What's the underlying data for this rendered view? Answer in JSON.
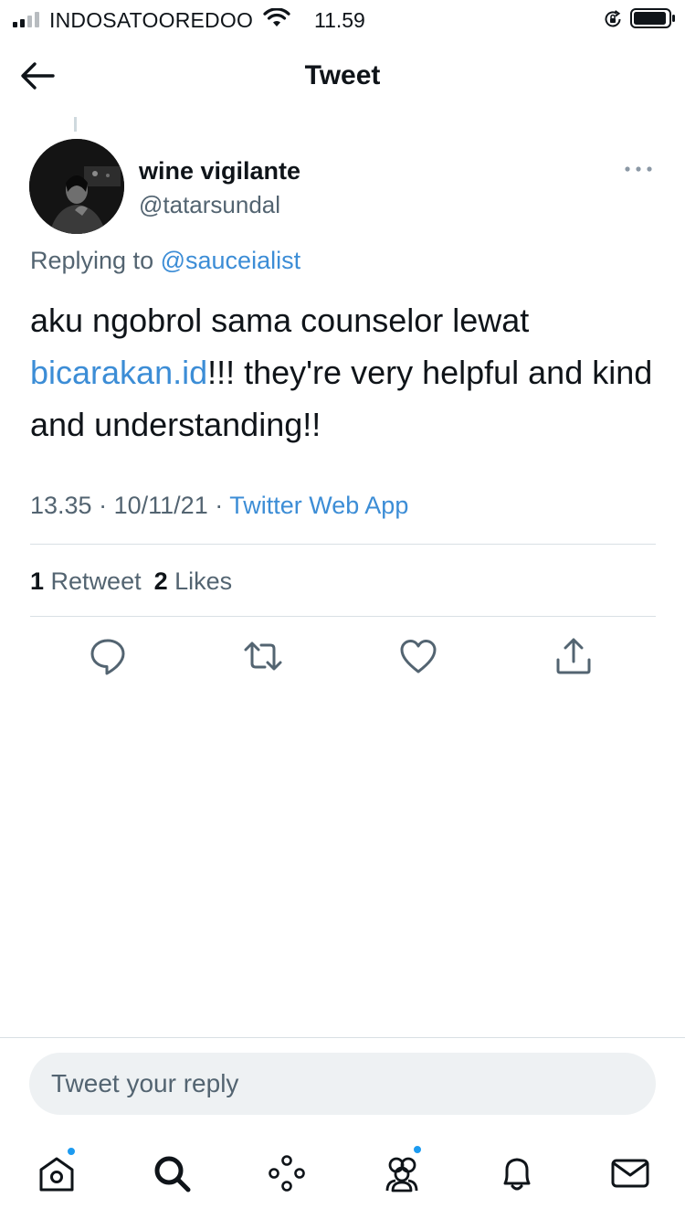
{
  "status_bar": {
    "carrier": "INDOSATOOREDOO",
    "time": "11.59"
  },
  "header": {
    "title": "Tweet",
    "back_icon": "arrow-left-icon"
  },
  "tweet": {
    "display_name": "wine vigilante",
    "handle": "@tatarsundal",
    "replying_prefix": "Replying to",
    "replying_to": "@sauceialist",
    "text_line1": "aku ngobrol sama counselor lewat",
    "text_link": "bicarakan.id",
    "text_after_link": "!!! they're very helpful and kind and understanding!!",
    "time": "13.35",
    "date": "10/11/21",
    "separator": "·",
    "source": "Twitter Web App",
    "retweet_count": "1",
    "retweet_label": "Retweet",
    "like_count": "2",
    "like_label": "Likes"
  },
  "actions": [
    "reply-icon",
    "retweet-icon",
    "like-icon",
    "share-icon"
  ],
  "reply_box": {
    "placeholder": "Tweet your reply"
  },
  "tabs": [
    "home-icon",
    "search-icon",
    "spaces-icon",
    "communities-icon",
    "notifications-icon",
    "messages-icon"
  ],
  "colors": {
    "link": "#3c8dd6",
    "notification_dot": "#1d9bf0",
    "secondary_text": "#536471"
  }
}
